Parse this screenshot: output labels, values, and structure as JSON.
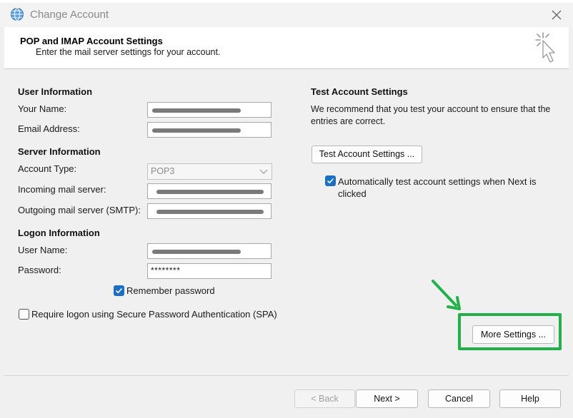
{
  "window": {
    "title": "Change Account"
  },
  "header": {
    "title": "POP and IMAP Account Settings",
    "subtitle": "Enter the mail server settings for your account."
  },
  "user_info": {
    "heading": "User Information",
    "name_label": "Your Name:",
    "email_label": "Email Address:"
  },
  "server_info": {
    "heading": "Server Information",
    "account_type_label": "Account Type:",
    "account_type_value": "POP3",
    "incoming_label": "Incoming mail server:",
    "outgoing_label": "Outgoing mail server (SMTP):"
  },
  "logon_info": {
    "heading": "Logon Information",
    "username_label": "User Name:",
    "password_label": "Password:",
    "password_value": "********",
    "remember_label": "Remember password",
    "spa_label": "Require logon using Secure Password Authentication (SPA)"
  },
  "test_settings": {
    "heading": "Test Account Settings",
    "description": "We recommend that you test your account to ensure that the entries are correct.",
    "test_button": "Test Account Settings ...",
    "auto_test_label": "Automatically test account settings when Next is clicked"
  },
  "more_settings_button": "More Settings ...",
  "footer": {
    "back": "< Back",
    "next": "Next >",
    "cancel": "Cancel",
    "help": "Help"
  },
  "colors": {
    "accent": "#1b6ec2",
    "highlight": "#22b04a"
  }
}
